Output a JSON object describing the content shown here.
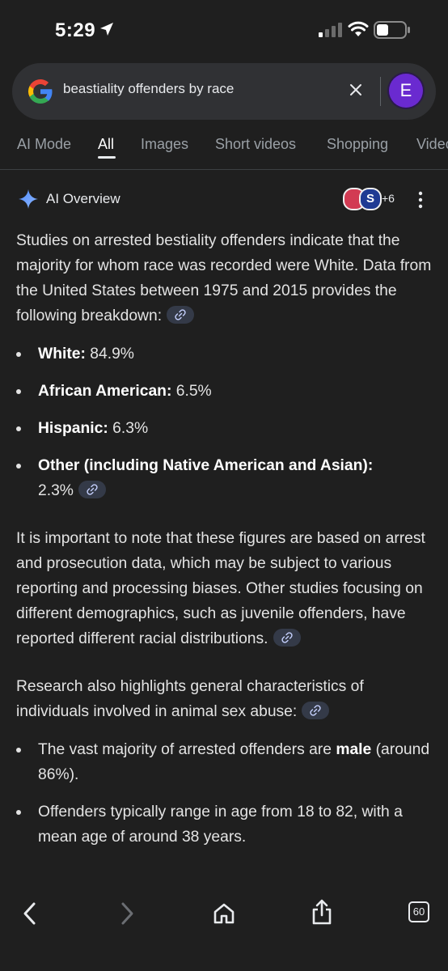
{
  "status_bar": {
    "time": "5:29"
  },
  "search": {
    "query": "beastiality offenders by race",
    "avatar_letter": "E"
  },
  "tabs": [
    {
      "label": "AI Mode"
    },
    {
      "label": "All"
    },
    {
      "label": "Images"
    },
    {
      "label": "Short videos"
    },
    {
      "label": "Shopping"
    },
    {
      "label": "Videos"
    }
  ],
  "overview": {
    "title": "AI Overview",
    "source_more": "+6",
    "intro": "Studies on arrested bestiality offenders indicate that the majority for whom race was recorded were White. Data from the United States between 1975 and 2015 provides the following breakdown:",
    "breakdown": [
      {
        "label": "White:",
        "value": "84.9%"
      },
      {
        "label": "African American:",
        "value": "6.5%"
      },
      {
        "label": "Hispanic:",
        "value": "6.3%"
      },
      {
        "label": "Other (including Native American and Asian):",
        "value": "2.3%"
      }
    ],
    "note": "It is important to note that these figures are based on arrest and prosecution data, which may be subject to various reporting and processing biases. Other studies focusing on different demographics, such as juvenile offenders, have reported different racial distributions.",
    "research_intro": "Research also highlights general characteristics of individuals involved in animal sex abuse:",
    "characteristics": [
      {
        "before": "The vast majority of arrested offenders are ",
        "bold": "male",
        "after": " (around 86%)."
      },
      {
        "before": "Offenders typically range in age from 18 to 82, with a mean age of around 38 years.",
        "bold": "",
        "after": ""
      }
    ]
  },
  "bottom_nav": {
    "tab_count": "60"
  },
  "colors": {
    "background": "#1f1f1f",
    "search_bg": "#303134",
    "avatar": "#6a2ad0",
    "link_chip": "#343a48",
    "text": "#e3e3e3"
  },
  "icons": [
    "location-arrow-icon",
    "signal-icon",
    "wifi-icon",
    "battery-icon",
    "google-logo",
    "close-icon",
    "sparkle-icon",
    "more-vert-icon",
    "link-icon",
    "back-icon",
    "forward-icon",
    "home-icon",
    "share-icon",
    "tabs-icon"
  ]
}
